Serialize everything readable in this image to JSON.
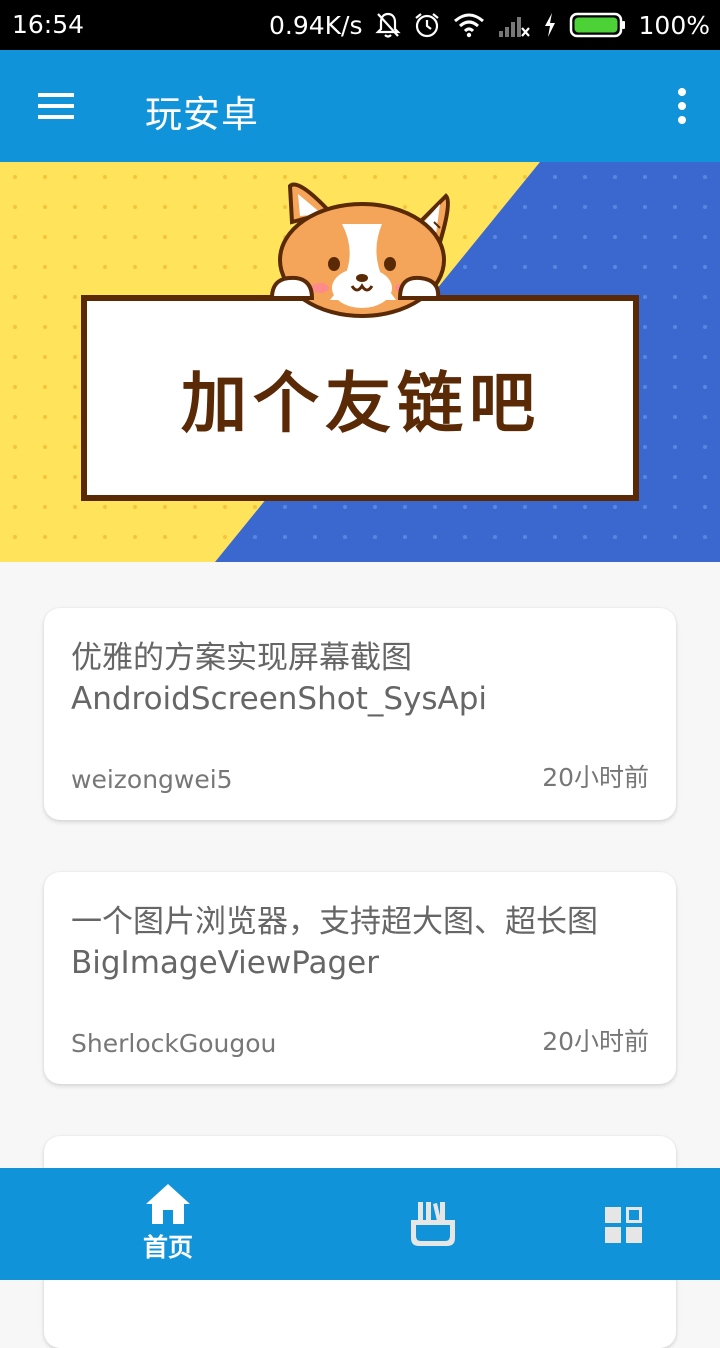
{
  "status_bar": {
    "time": "16:54",
    "speed": "0.94K/s",
    "battery": "100%",
    "icons": [
      "bell-off-icon",
      "alarm-icon",
      "wifi-icon",
      "signal-icon",
      "charging-icon",
      "battery-icon"
    ]
  },
  "app_bar": {
    "title": "玩安卓",
    "menu_icon": "hamburger-menu-icon",
    "more_icon": "more-vert-icon"
  },
  "banner": {
    "text": "加个友链吧",
    "image": "corgi-dog-illustration"
  },
  "articles": [
    {
      "title": "优雅的方案实现屏幕截图AndroidScreenShot_SysApi",
      "author": "weizongwei5",
      "time": "20小时前"
    },
    {
      "title": "一个图片浏览器，支持超大图、超长图 BigImageViewPager",
      "author": "SherlockGougou",
      "time": "20小时前"
    }
  ],
  "bottom_nav": {
    "items": [
      {
        "label": "首页",
        "icon": "home-icon",
        "active": true
      },
      {
        "label": "",
        "icon": "books-icon",
        "active": false
      },
      {
        "label": "",
        "icon": "grid-icon",
        "active": false
      }
    ]
  },
  "colors": {
    "primary": "#1193da",
    "banner_yellow": "#ffe35a",
    "banner_blue": "#3b68cf",
    "banner_text": "#5a2a06"
  }
}
